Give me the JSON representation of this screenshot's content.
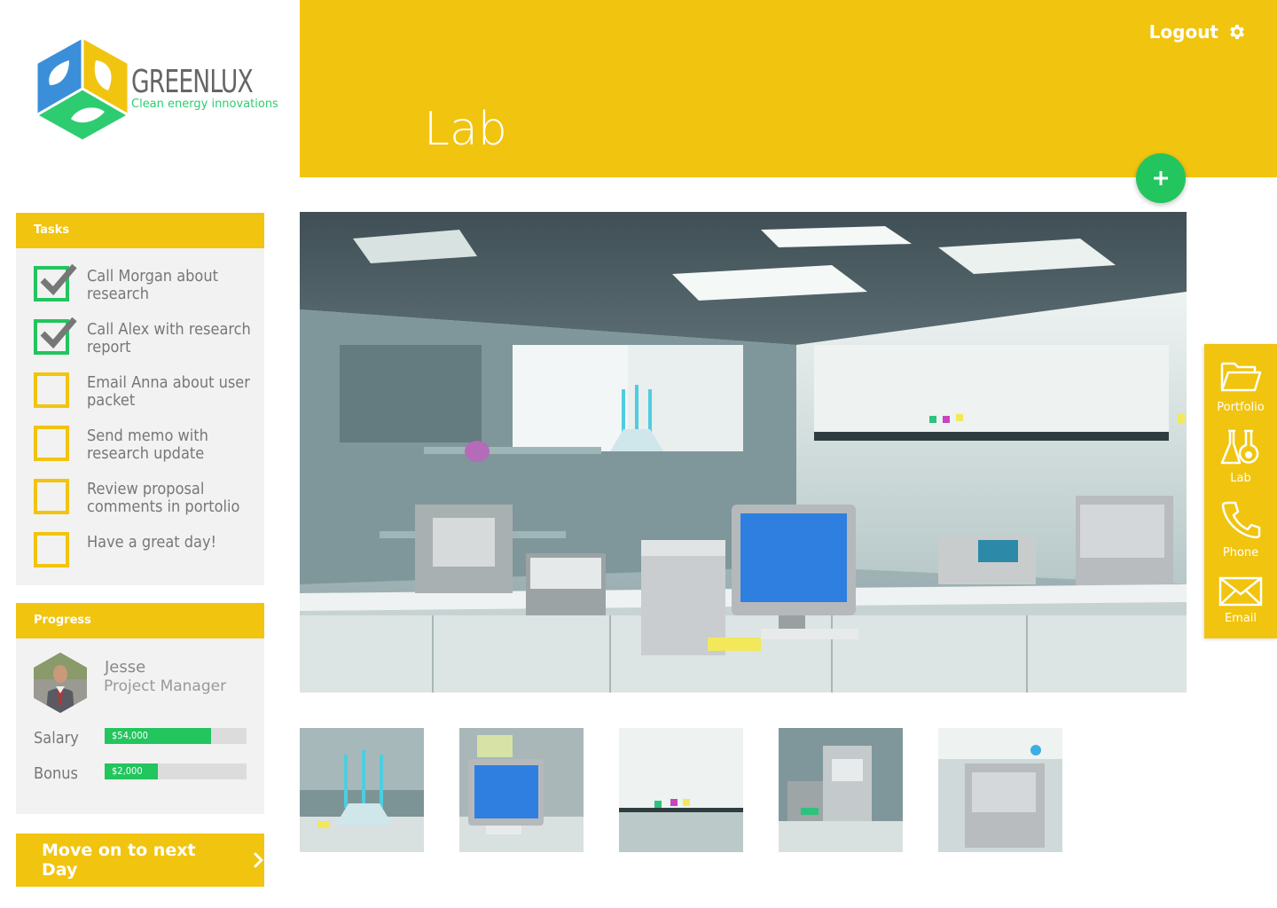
{
  "brand": {
    "name": "GREENLUX",
    "tagline": "Clean energy innovations",
    "colors": {
      "yellow": "#f1c40f",
      "green": "#22c55e",
      "blue": "#3b8fd9"
    }
  },
  "header": {
    "title": "Lab",
    "logout_label": "Logout",
    "settings_icon": "gear-icon",
    "add_icon": "plus-icon"
  },
  "tasks": {
    "heading": "Tasks",
    "items": [
      {
        "label": "Call Morgan about research",
        "done": true
      },
      {
        "label": "Call Alex with research report",
        "done": true
      },
      {
        "label": "Email Anna about user packet",
        "done": false
      },
      {
        "label": "Send memo with research update",
        "done": false
      },
      {
        "label": "Review proposal comments in portolio",
        "done": false
      },
      {
        "label": "Have a great day!",
        "done": false
      }
    ]
  },
  "progress": {
    "heading": "Progress",
    "person": {
      "name": "Jesse",
      "role": "Project Manager"
    },
    "salary": {
      "label": "Salary",
      "value": "$54,000",
      "fraction": 0.75
    },
    "bonus": {
      "label": "Bonus",
      "value": "$2,000",
      "fraction": 0.375
    }
  },
  "next_day": {
    "label": "Move on to next Day",
    "icon": "chevron-right-icon"
  },
  "gallery": {
    "main": "lab-interior",
    "thumbnails": [
      "flasks",
      "computer",
      "cabinets",
      "microscope",
      "instrument"
    ]
  },
  "right_nav": [
    {
      "label": "Portfolio",
      "icon": "folder-icon"
    },
    {
      "label": "Lab",
      "icon": "flask-icon"
    },
    {
      "label": "Phone",
      "icon": "phone-icon"
    },
    {
      "label": "Email",
      "icon": "envelope-icon"
    }
  ]
}
